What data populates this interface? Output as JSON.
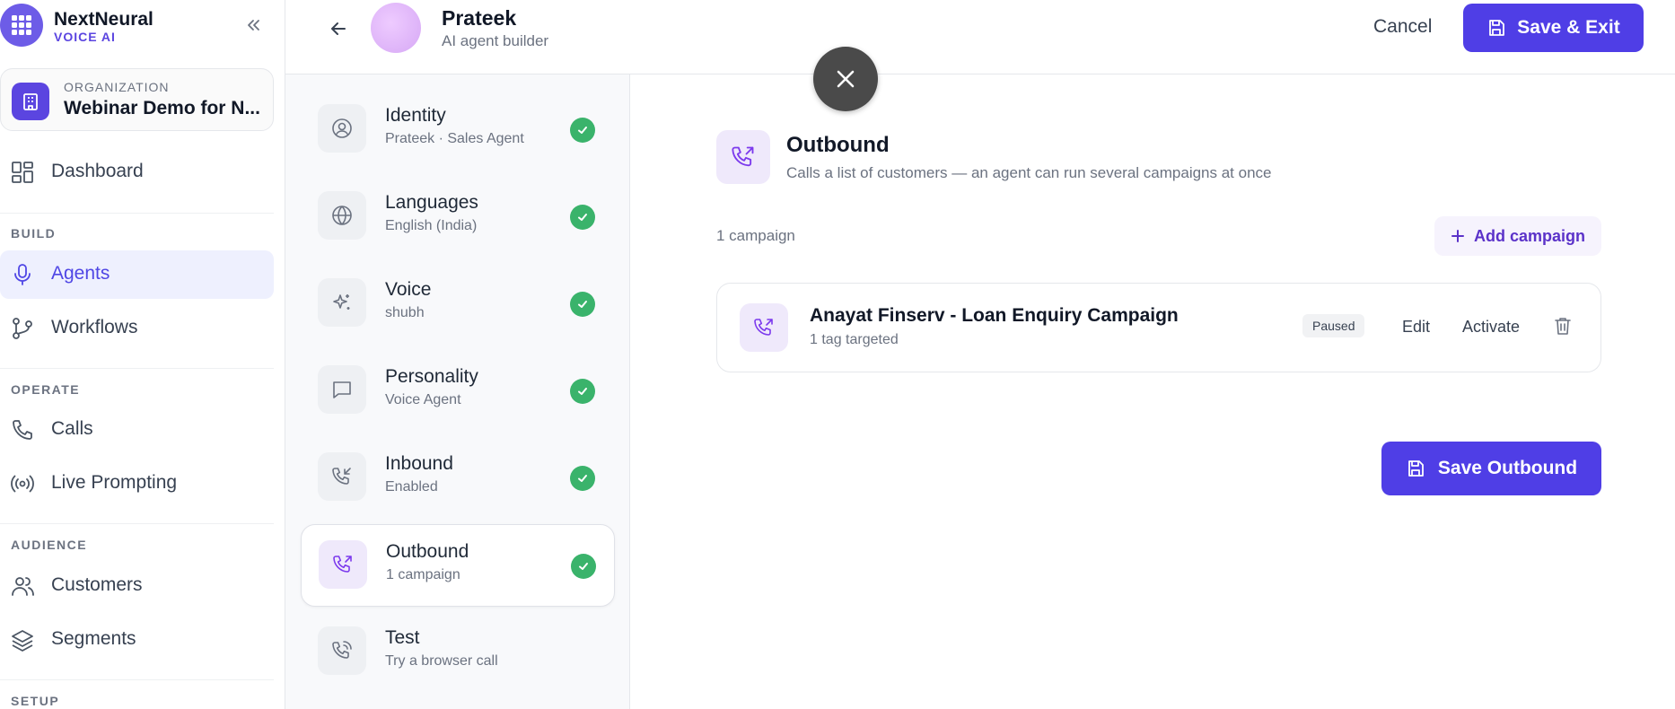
{
  "brand": {
    "name": "NextNeural",
    "subtitle": "VOICE AI"
  },
  "organization": {
    "label": "ORGANIZATION",
    "name": "Webinar Demo for N..."
  },
  "sidebar": {
    "items": [
      {
        "label": "Dashboard",
        "icon": "dashboard-icon"
      },
      {
        "label": "Agents",
        "icon": "microphone-icon",
        "active": true
      },
      {
        "label": "Workflows",
        "icon": "workflow-icon"
      },
      {
        "label": "Calls",
        "icon": "phone-icon"
      },
      {
        "label": "Live Prompting",
        "icon": "broadcast-icon"
      },
      {
        "label": "Customers",
        "icon": "users-icon"
      },
      {
        "label": "Segments",
        "icon": "layers-icon"
      }
    ],
    "sections": {
      "build": "BUILD",
      "operate": "OPERATE",
      "audience": "AUDIENCE",
      "setup": "SETUP"
    }
  },
  "header": {
    "agent_name": "Prateek",
    "agent_subtitle": "AI agent builder",
    "cancel_label": "Cancel",
    "save_exit_label": "Save & Exit"
  },
  "steps": [
    {
      "title": "Identity",
      "subtitle": "Prateek · Sales Agent",
      "icon": "user-circle-icon",
      "done": true
    },
    {
      "title": "Languages",
      "subtitle": "English (India)",
      "icon": "globe-icon",
      "done": true
    },
    {
      "title": "Voice",
      "subtitle": "shubh",
      "icon": "sparkles-icon",
      "done": true
    },
    {
      "title": "Personality",
      "subtitle": "Voice Agent",
      "icon": "message-icon",
      "done": true
    },
    {
      "title": "Inbound",
      "subtitle": "Enabled",
      "icon": "phone-incoming-icon",
      "done": true
    },
    {
      "title": "Outbound",
      "subtitle": "1 campaign",
      "icon": "phone-outgoing-icon",
      "done": true,
      "active": true
    },
    {
      "title": "Test",
      "subtitle": "Try a browser call",
      "icon": "phone-call-icon",
      "done": false
    }
  ],
  "outbound": {
    "title": "Outbound",
    "description": "Calls a list of customers — an agent can run several campaigns at once",
    "campaign_count": "1 campaign",
    "add_campaign_label": "Add campaign",
    "campaigns": [
      {
        "name": "Anayat Finserv - Loan Enquiry Campaign",
        "subtitle": "1 tag targeted",
        "status": "Paused",
        "edit_label": "Edit",
        "activate_label": "Activate"
      }
    ],
    "save_label": "Save Outbound"
  },
  "colors": {
    "accent": "#4f3ee6",
    "success": "#3ab36b",
    "active_nav_bg": "#eef0fe"
  }
}
